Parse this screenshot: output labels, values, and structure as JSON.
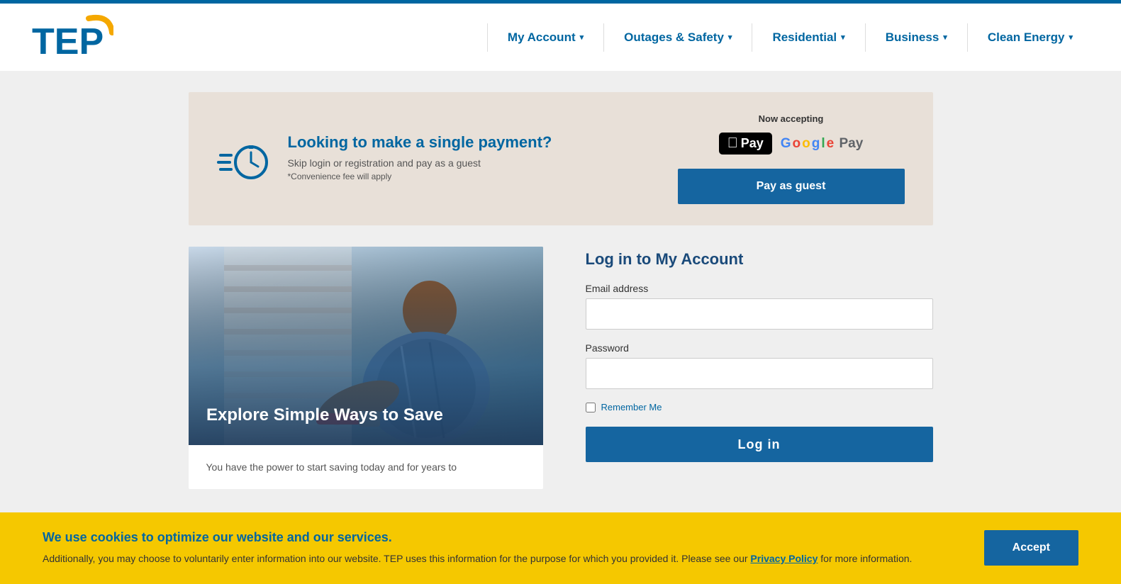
{
  "header": {
    "logo_text": "TEP",
    "nav_items": [
      {
        "id": "my-account",
        "label": "My Account"
      },
      {
        "id": "outages-safety",
        "label": "Outages & Safety"
      },
      {
        "id": "residential",
        "label": "Residential"
      },
      {
        "id": "business",
        "label": "Business"
      },
      {
        "id": "clean-energy",
        "label": "Clean Energy"
      }
    ]
  },
  "payment_banner": {
    "heading": "Looking to make a single payment?",
    "subtext": "Skip login or registration and pay as a guest",
    "note": "*Convenience fee will apply",
    "accepting_label": "Now accepting",
    "button_label": "Pay as guest"
  },
  "image_card": {
    "overlay_title": "Explore Simple Ways to Save",
    "description": "You have the power to start saving today and for years to"
  },
  "login_form": {
    "title": "Log in to My Account",
    "email_label": "Email address",
    "email_placeholder": "",
    "password_label": "Password",
    "password_placeholder": "",
    "remember_me_label": "Remember Me",
    "button_label": "Log in"
  },
  "cookie_banner": {
    "title": "We use cookies to optimize our website and our services.",
    "body": "Additionally, you may choose to voluntarily enter information into our website. TEP uses this information for the purpose for which you provided it. Please see our ",
    "link_text": "Privacy Policy",
    "body_suffix": " for more information.",
    "accept_button": "Accept"
  }
}
